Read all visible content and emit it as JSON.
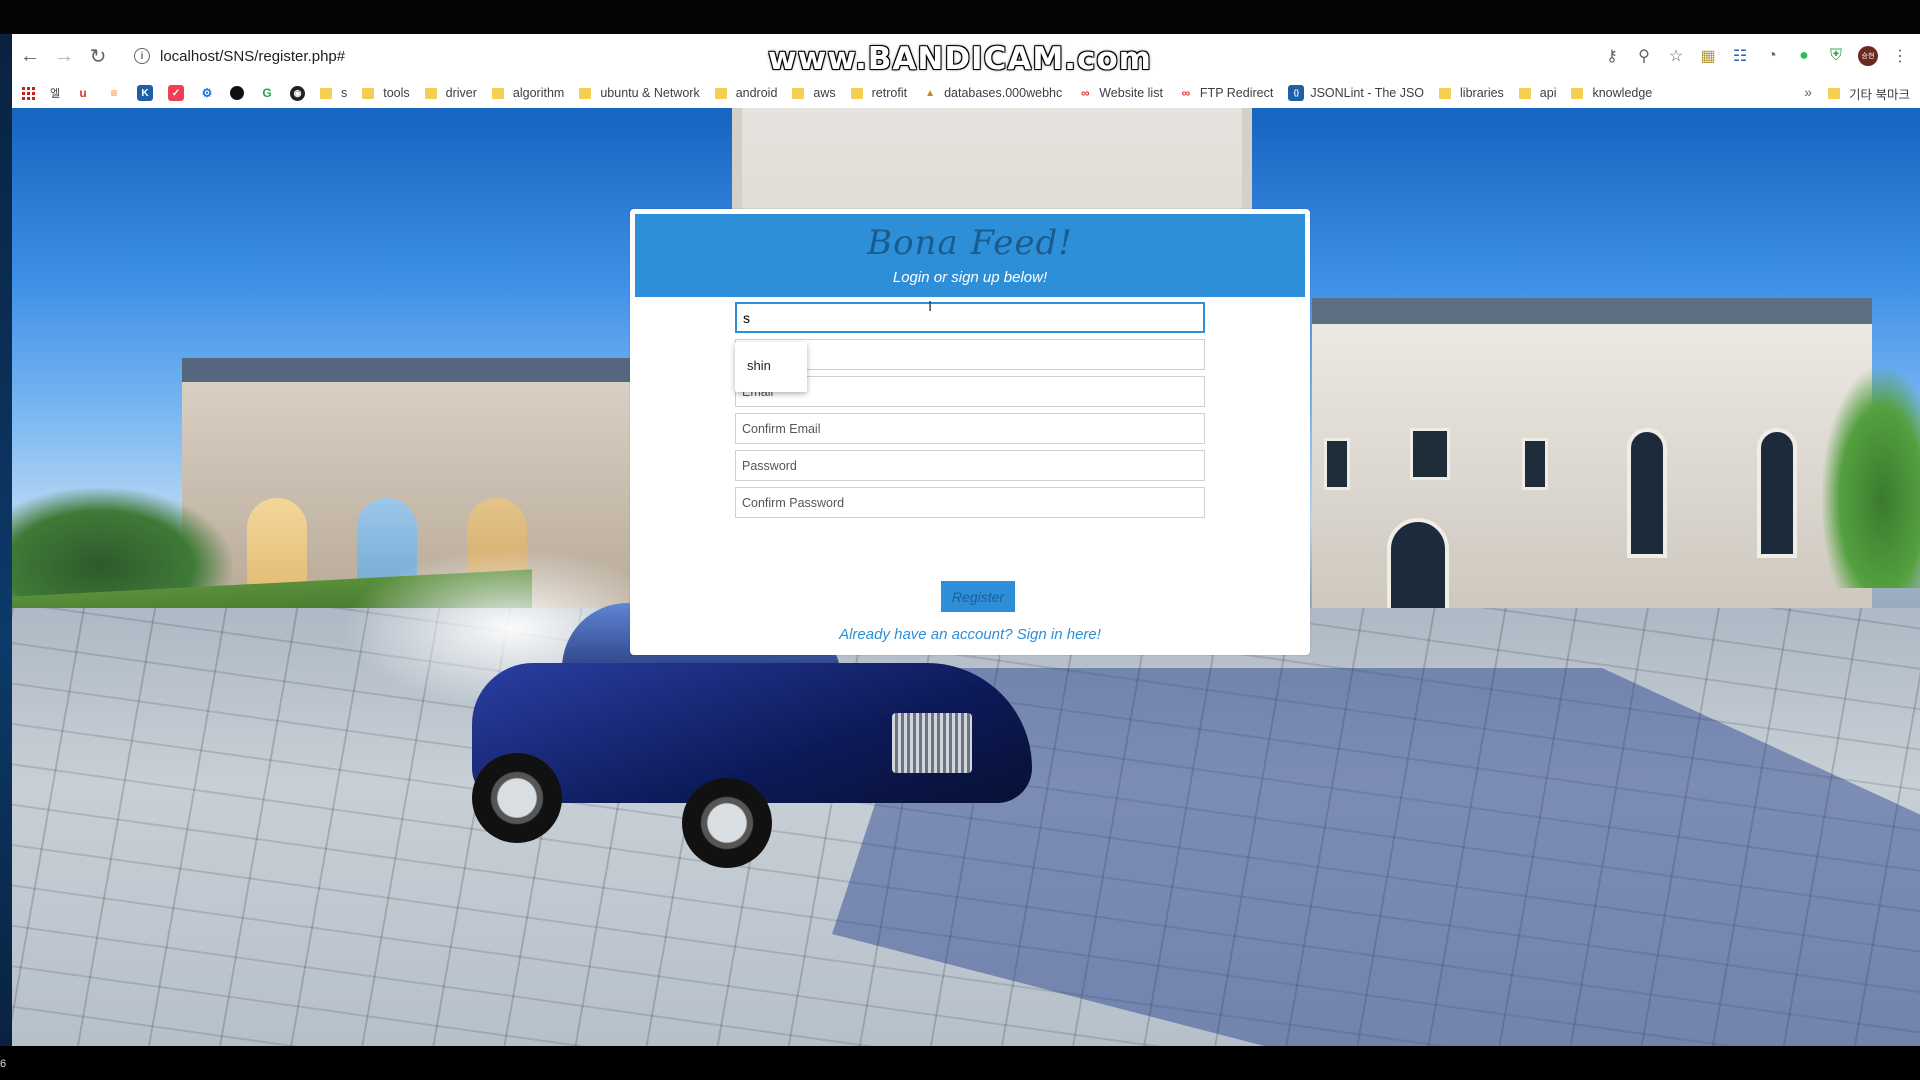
{
  "watermark": "www.BANDICAM.com",
  "browser": {
    "url": "localhost/SNS/register.php#",
    "toolbar_icons": [
      "back-icon",
      "forward-icon",
      "reload-icon",
      "info-icon",
      "key-icon",
      "zoom-icon",
      "star-icon",
      "extension-icon",
      "extension-icon",
      "pocket-icon",
      "evernote-icon",
      "shield-icon",
      "profile-avatar",
      "menu-icon"
    ],
    "bookmarks": [
      {
        "label": "s"
      },
      {
        "label": "tools"
      },
      {
        "label": "driver"
      },
      {
        "label": "algorithm"
      },
      {
        "label": "ubuntu & Network"
      },
      {
        "label": "android"
      },
      {
        "label": "aws"
      },
      {
        "label": "retrofit"
      },
      {
        "label": "databases.000webhc"
      },
      {
        "label": "Website list"
      },
      {
        "label": "FTP Redirect"
      },
      {
        "label": "JSONLint - The JSO"
      },
      {
        "label": "libraries"
      },
      {
        "label": "api"
      },
      {
        "label": "knowledge"
      }
    ],
    "bookmark_short": "엘",
    "other_bookmarks": "기타 북마크",
    "more": "»",
    "profile_initials": "승현"
  },
  "card": {
    "title": "Bona Feed!",
    "subtitle": "Login or sign up below!",
    "first_field_value": "s",
    "autocomplete_option": "shin",
    "email_placeholder": "Email",
    "confirm_email_placeholder": "Confirm Email",
    "password_placeholder": "Password",
    "confirm_password_placeholder": "Confirm Password",
    "register_label": "Register",
    "signin_text": "Already have an account? Sign in here!"
  },
  "taskbar_char": "6",
  "colors": {
    "accent": "#2d8fd8",
    "title_text": "#1a5c8e"
  }
}
